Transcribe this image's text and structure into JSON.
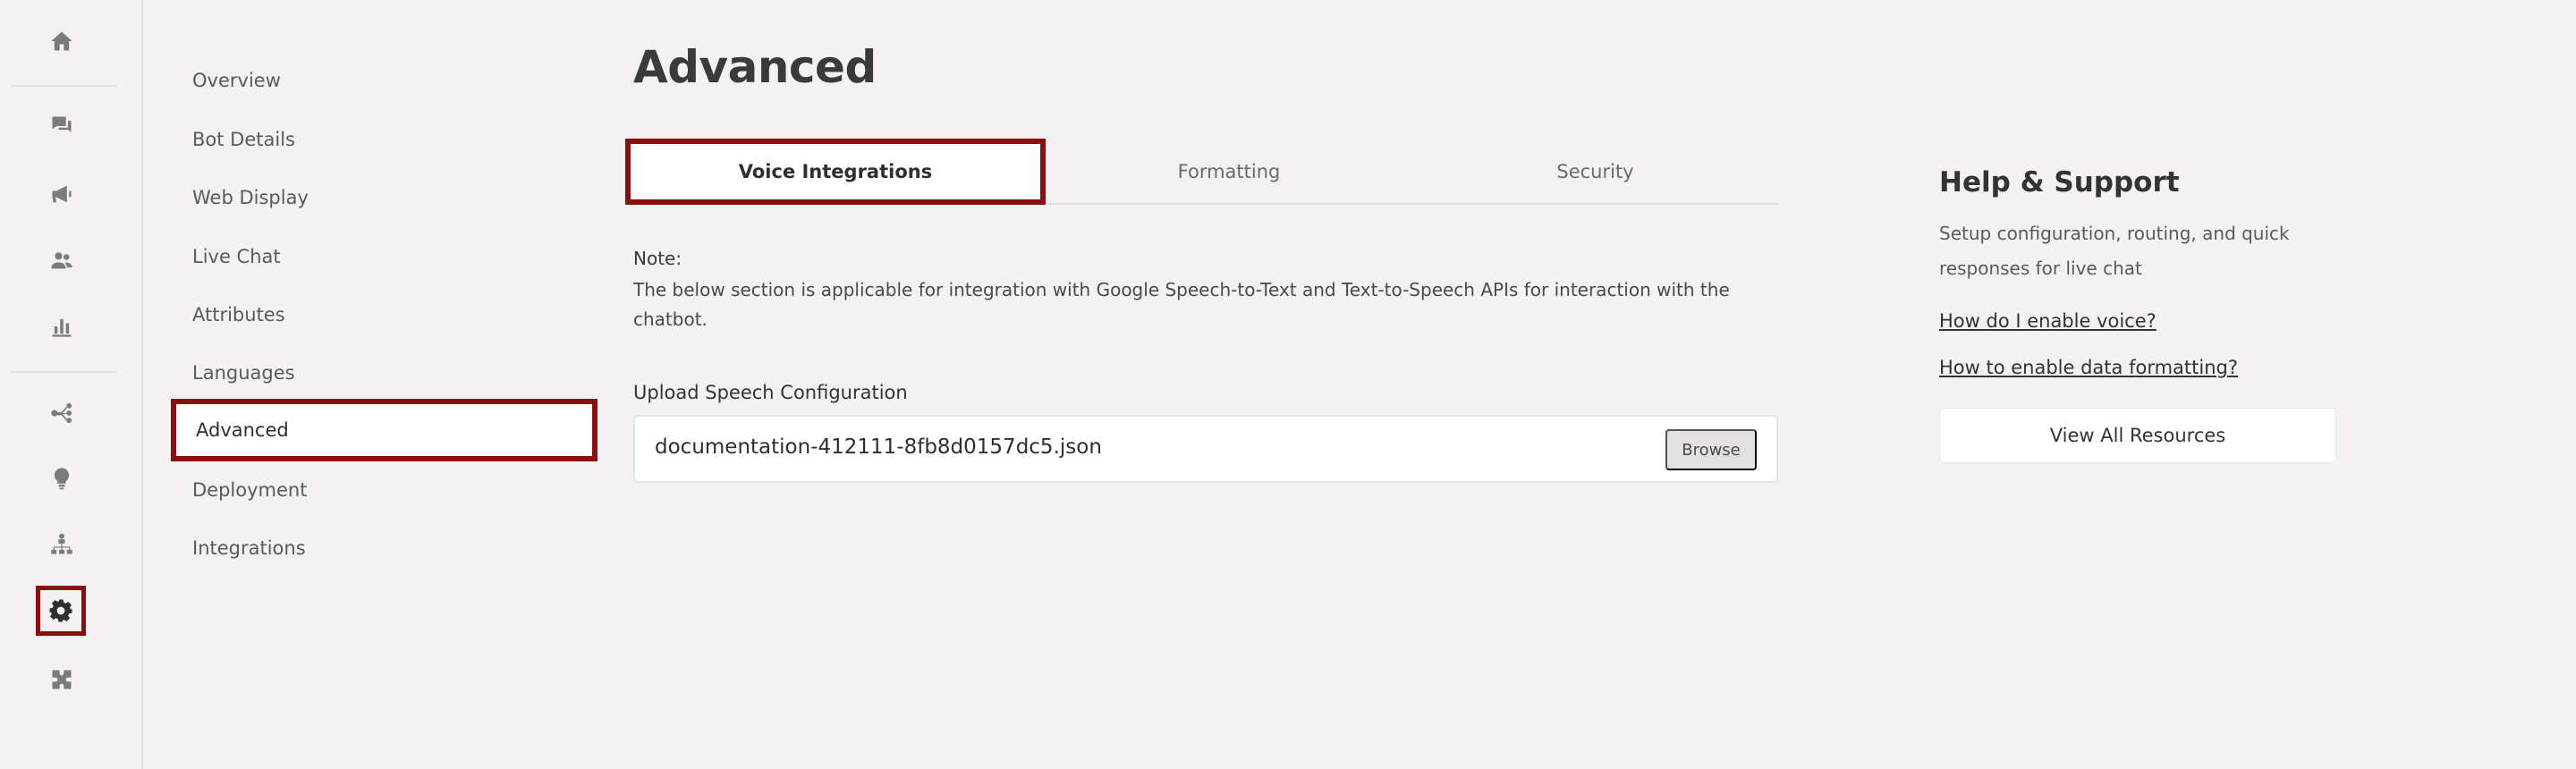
{
  "rail": {
    "icons": [
      "home-icon",
      "chat-icon",
      "megaphone-icon",
      "users-icon",
      "bar-chart-icon",
      "flow-icon",
      "lightbulb-icon",
      "hierarchy-icon",
      "gear-icon",
      "puzzle-icon"
    ],
    "active": "gear-icon"
  },
  "nav": {
    "items": [
      {
        "label": "Overview"
      },
      {
        "label": "Bot Details"
      },
      {
        "label": "Web Display"
      },
      {
        "label": "Live Chat"
      },
      {
        "label": "Attributes"
      },
      {
        "label": "Languages"
      },
      {
        "label": "Advanced"
      },
      {
        "label": "Deployment"
      },
      {
        "label": "Integrations"
      }
    ],
    "active": "Advanced"
  },
  "page": {
    "title": "Advanced"
  },
  "tabs": [
    {
      "label": "Voice Integrations"
    },
    {
      "label": "Formatting"
    },
    {
      "label": "Security"
    }
  ],
  "active_tab": "Voice Integrations",
  "note": {
    "label": "Note:",
    "text": "The below section is applicable for integration with Google Speech-to-Text and Text-to-Speech APIs for interaction with the chatbot."
  },
  "upload": {
    "label": "Upload Speech Configuration",
    "value": "documentation-412111-8fb8d0157dc5.json",
    "browse_label": "Browse"
  },
  "help": {
    "title": "Help & Support",
    "description": "Setup configuration, routing, and quick responses for live chat",
    "links": [
      {
        "label": "How do I enable voice?"
      },
      {
        "label": "How to enable data formatting?"
      }
    ],
    "resources_button": "View All Resources"
  },
  "colors": {
    "highlight": "#8b0f0f",
    "background": "#f3f1f2",
    "panel": "#ffffff"
  }
}
